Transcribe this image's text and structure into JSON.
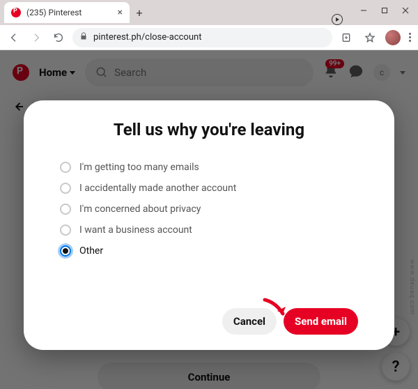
{
  "browser": {
    "tab_title": "(235) Pinterest",
    "url": "pinterest.ph/close-account"
  },
  "topbar": {
    "home_label": "Home",
    "search_placeholder": "Search",
    "notification_count": "99+",
    "user_initial": "c"
  },
  "back_label": "Back",
  "continue_label": "Continue",
  "modal": {
    "title": "Tell us why you're leaving",
    "options": [
      "I'm getting too many emails",
      "I accidentally made another account",
      "I'm concerned about privacy",
      "I want a business account",
      "Other"
    ],
    "cancel_label": "Cancel",
    "submit_label": "Send email"
  },
  "fab": {
    "plus": "+",
    "help": "?"
  },
  "watermark": "www.deuaq.com"
}
